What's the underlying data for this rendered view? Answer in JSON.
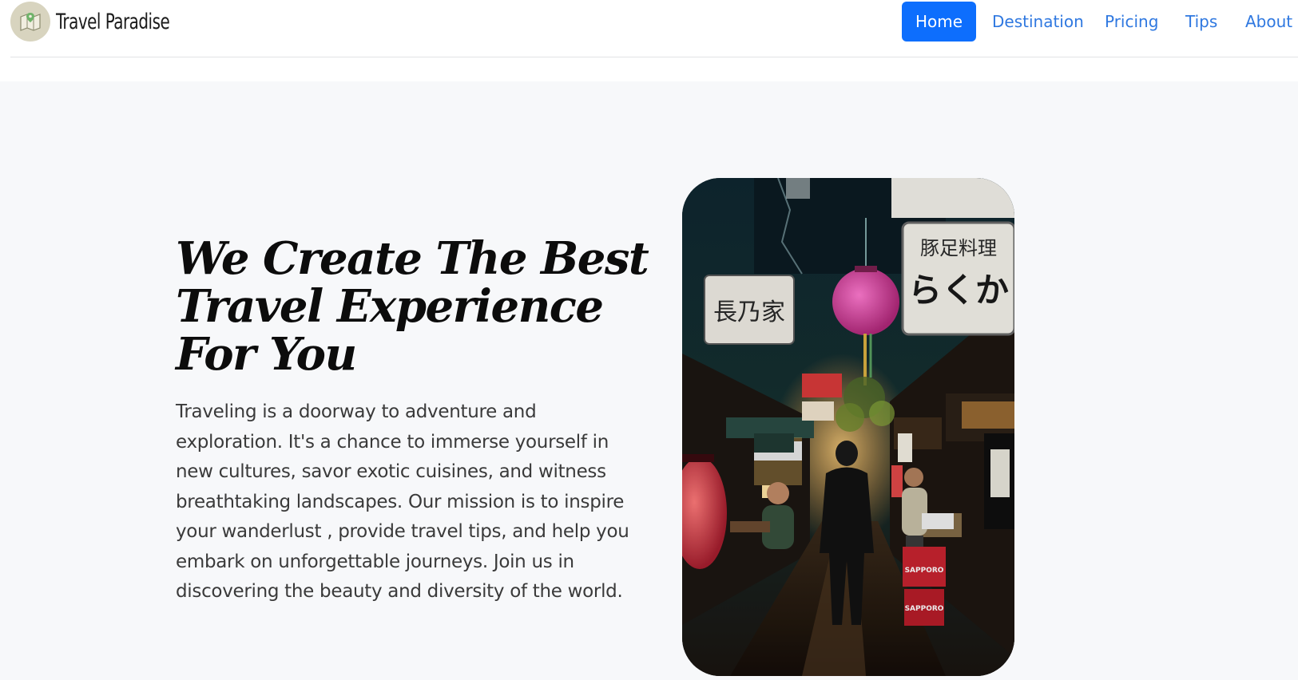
{
  "brand": {
    "name": "Travel Paradise",
    "logo_icon": "map-globe-icon"
  },
  "nav": {
    "items": [
      {
        "label": "Home",
        "active": true
      },
      {
        "label": "Destination",
        "active": false
      },
      {
        "label": "Pricing",
        "active": false
      },
      {
        "label": "Tips",
        "active": false
      },
      {
        "label": "About",
        "active": false
      }
    ]
  },
  "hero": {
    "title": "We Create The Best Travel Experience For You",
    "text": "Traveling is a doorway to adventure and exploration. It's a chance to immerse yourself in new cultures, savor exotic cuisines, and witness breathtaking landscapes. Our mission is to inspire your wanderlust , provide travel tips, and help you embark on unforgettable journeys. Join us in discovering the beauty and diversity of the world."
  },
  "hero_image": {
    "sign_left": "長乃家",
    "sign_right_top": "豚足料理",
    "sign_right_bottom": "らくか",
    "crate_label": "SAPPORO"
  },
  "colors": {
    "primary": "#0d6efd",
    "link": "#2f78e0",
    "hero_bg": "#f7f8fa",
    "title": "#0c0c0c",
    "body_text": "#3a3a3a"
  }
}
